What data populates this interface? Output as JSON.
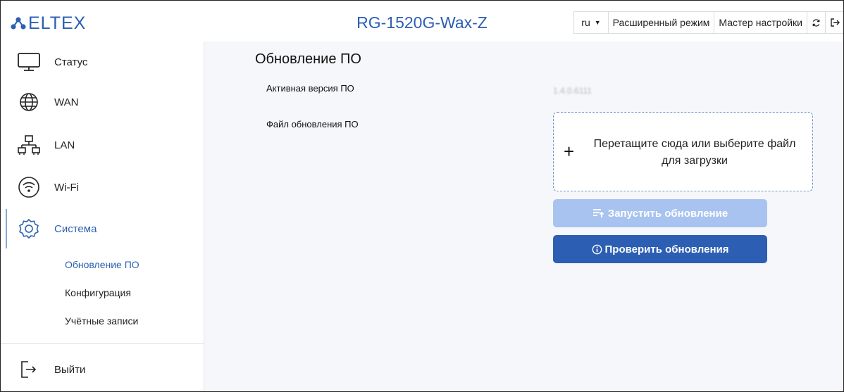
{
  "header": {
    "logo_text": "ELTEX",
    "device_title": "RG-1520G-Wax-Z",
    "lang": "ru",
    "advanced_mode": "Расширенный режим",
    "setup_wizard": "Мастер настройки"
  },
  "sidebar": {
    "items": [
      {
        "label": "Статус",
        "icon": "monitor-icon"
      },
      {
        "label": "WAN",
        "icon": "globe-icon"
      },
      {
        "label": "LAN",
        "icon": "network-icon"
      },
      {
        "label": "Wi-Fi",
        "icon": "wifi-icon"
      },
      {
        "label": "Система",
        "icon": "gear-icon"
      }
    ],
    "subitems": [
      {
        "label": "Обновление ПО"
      },
      {
        "label": "Конфигурация"
      },
      {
        "label": "Учётные записи"
      }
    ],
    "logout": "Выйти"
  },
  "main": {
    "title": "Обновление ПО",
    "active_version_label": "Активная версия ПО",
    "active_version_value": "1.4.0.6111",
    "file_label": "Файл обновления ПО",
    "dropzone_text": "Перетащите сюда или выберите файл для загрузки",
    "start_update": "Запустить обновление",
    "check_updates": "Проверить обновления"
  },
  "colors": {
    "accent": "#2c5fb3",
    "disabled_button": "#a8c3ef",
    "background": "#f6f7fb"
  }
}
